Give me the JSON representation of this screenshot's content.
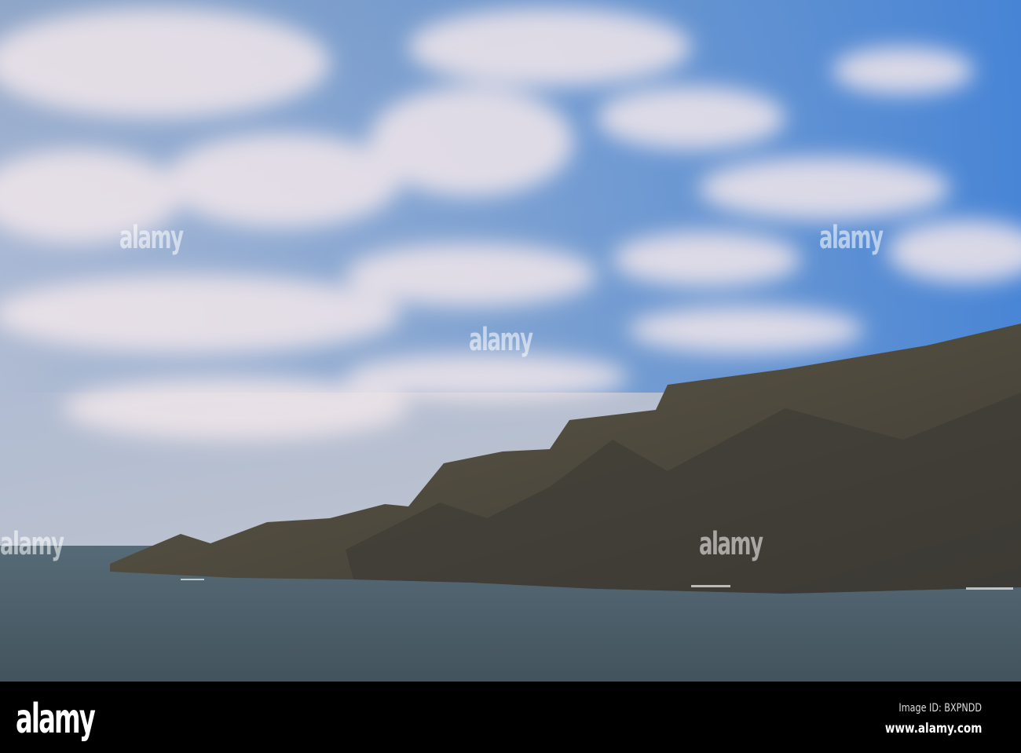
{
  "watermark": "alamy",
  "footer": {
    "logo": "alamy",
    "image_id": "Image ID: BXPNDD",
    "website": "www.alamy.com"
  },
  "colors": {
    "sky_top": "#4a86d0",
    "sky_low": "#c9cbd6",
    "sea": "#4b5f6a",
    "cliff": "#4e4b40",
    "bar": "#000000"
  }
}
